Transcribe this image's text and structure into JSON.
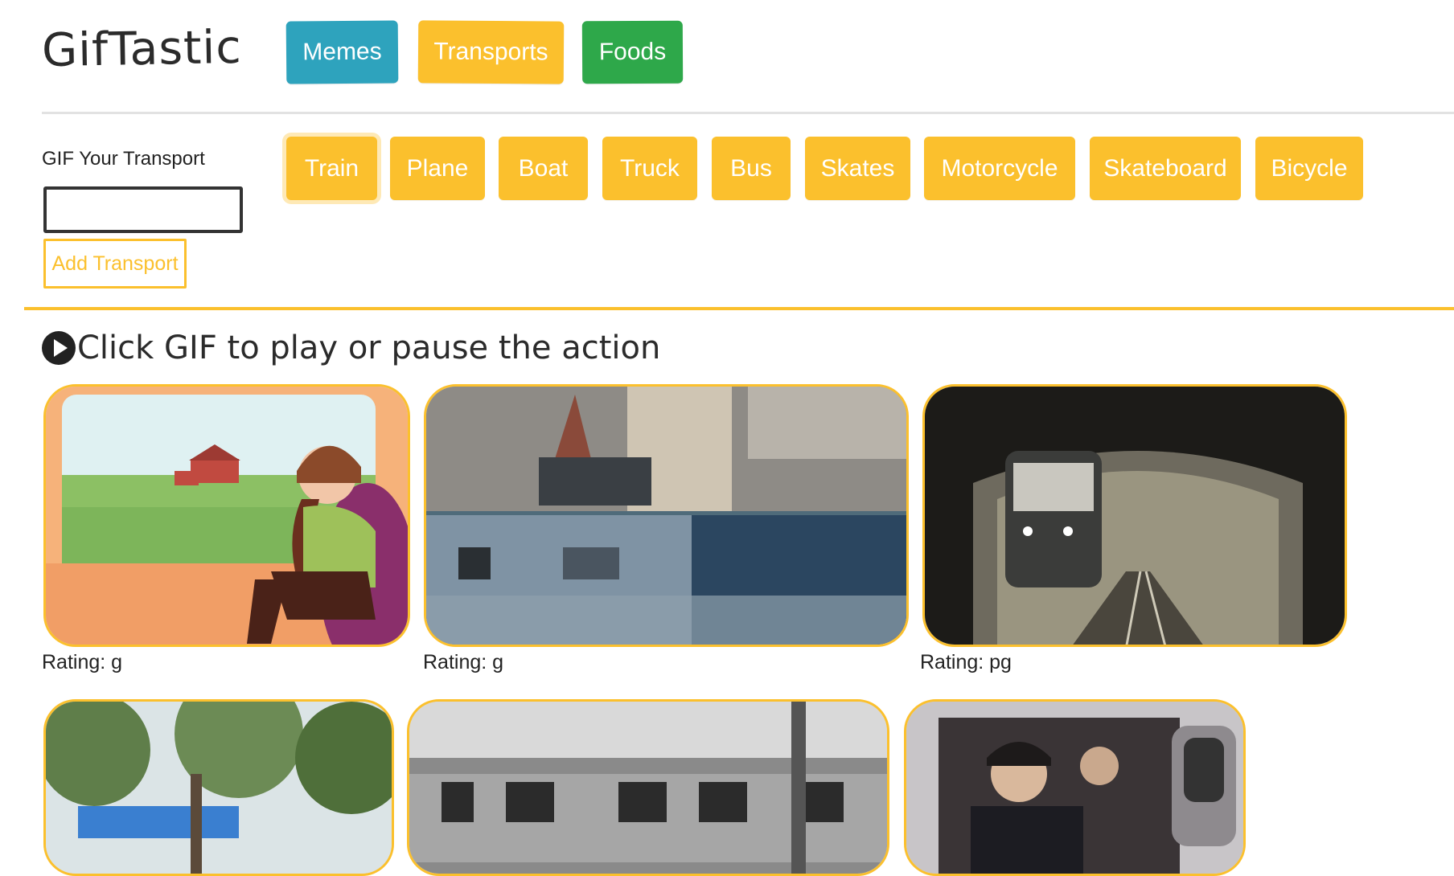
{
  "app": {
    "title": "GifTastic"
  },
  "categories": [
    {
      "label": "Memes",
      "color": "#2ea3bd"
    },
    {
      "label": "Transports",
      "color": "#fbc02d"
    },
    {
      "label": "Foods",
      "color": "#2ea84a"
    }
  ],
  "form": {
    "label": "GIF Your Transport",
    "input_value": "",
    "add_button": "Add Transport"
  },
  "topics": [
    "Train",
    "Plane",
    "Boat",
    "Truck",
    "Bus",
    "Skates",
    "Motorcycle",
    "Skateboard",
    "Bicycle"
  ],
  "active_topic": "Train",
  "instruction": "Click GIF to play or pause the action",
  "gifs": [
    {
      "rating": "Rating: g"
    },
    {
      "rating": "Rating: g"
    },
    {
      "rating": "Rating: pg"
    },
    {
      "rating": ""
    },
    {
      "rating": ""
    },
    {
      "rating": ""
    }
  ],
  "accent_color": "#fbc02d"
}
